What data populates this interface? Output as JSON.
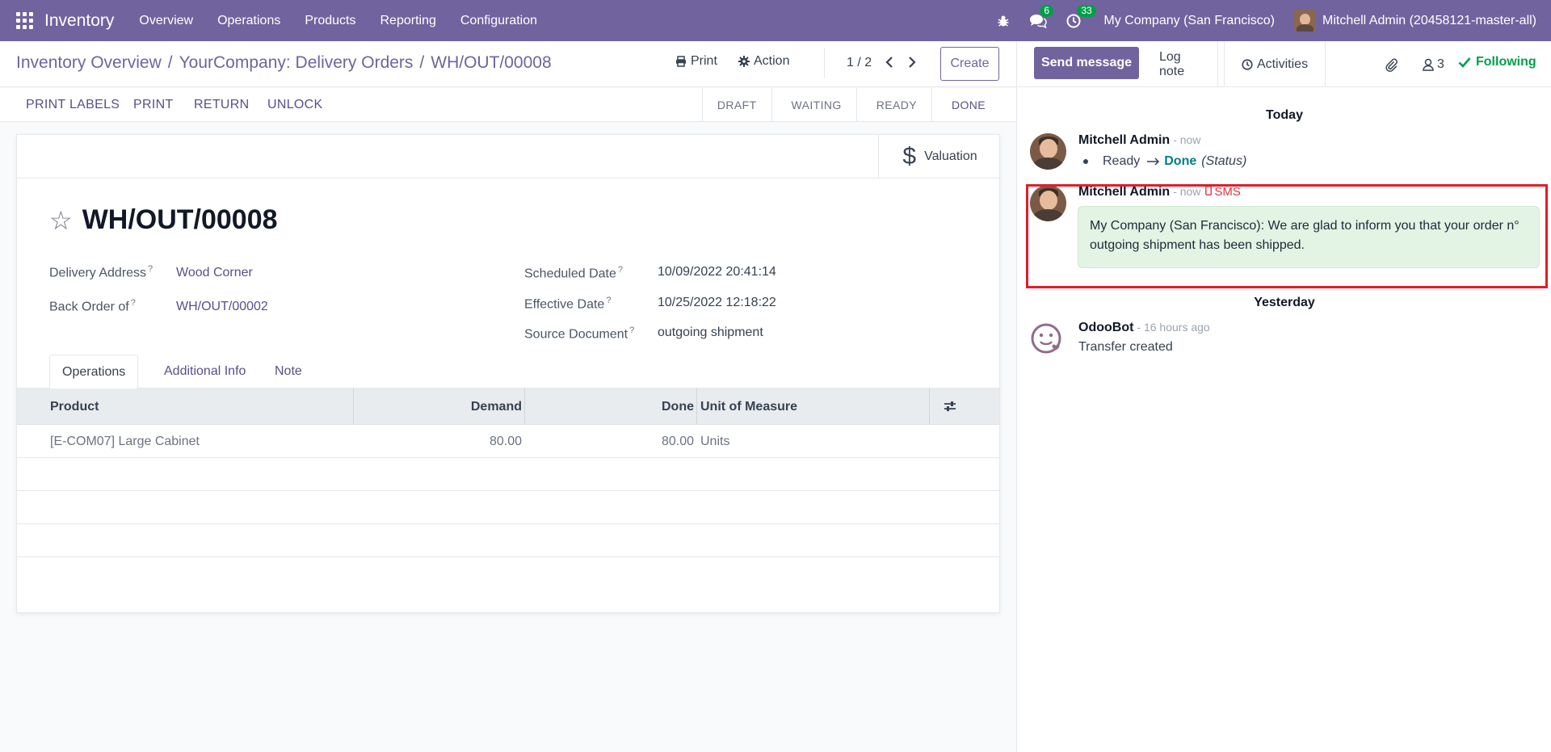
{
  "navbar": {
    "app_name": "Inventory",
    "menu": [
      "Overview",
      "Operations",
      "Products",
      "Reporting",
      "Configuration"
    ],
    "messages_count": "6",
    "activities_count": "33",
    "company": "My Company (San Francisco)",
    "user": "Mitchell Admin (20458121-master-all)",
    "colors": {
      "navbar": "#71639e",
      "badge": "#00a04a"
    }
  },
  "breadcrumb": {
    "items": [
      "Inventory Overview",
      "YourCompany: Delivery Orders"
    ],
    "current": "WH/OUT/00008"
  },
  "control": {
    "print": "Print",
    "action": "Action",
    "pager": "1 / 2",
    "create": "Create"
  },
  "statusbar": {
    "actions": [
      "PRINT LABELS",
      "PRINT",
      "RETURN",
      "UNLOCK"
    ],
    "steps": [
      "DRAFT",
      "WAITING",
      "READY",
      "DONE"
    ],
    "current_step": "DONE"
  },
  "form": {
    "valuation": "Valuation",
    "title": "WH/OUT/00008",
    "delivery_address_label": "Delivery Address",
    "delivery_address": "Wood Corner",
    "back_order_label": "Back Order of",
    "back_order": "WH/OUT/00002",
    "scheduled_date_label": "Scheduled Date",
    "scheduled_date": "10/09/2022 20:41:14",
    "effective_date_label": "Effective Date",
    "effective_date": "10/25/2022 12:18:22",
    "source_document_label": "Source Document",
    "source_document": "outgoing shipment",
    "help_mark": "?",
    "tabs": [
      "Operations",
      "Additional Info",
      "Note"
    ],
    "table": {
      "headers": [
        "Product",
        "Demand",
        "Done",
        "Unit of Measure"
      ],
      "rows": [
        {
          "product": "[E-COM07] Large Cabinet",
          "demand": "80.00",
          "done": "80.00",
          "uom": "Units"
        }
      ]
    }
  },
  "chatter": {
    "send_message": "Send message",
    "log_note": "Log note",
    "activities": "Activities",
    "followers_count": "3",
    "following": "Following",
    "today": "Today",
    "yesterday": "Yesterday",
    "messages": [
      {
        "author": "Mitchell Admin",
        "time": "- now",
        "tracking_from": "Ready",
        "tracking_to": "Done",
        "tracking_field": "(Status)"
      },
      {
        "author": "Mitchell Admin",
        "time": "- now",
        "type": "SMS",
        "body": "My Company (San Francisco): We are glad to inform you that your order n° outgoing shipment has been shipped."
      },
      {
        "author": "OdooBot",
        "time": "- 16 hours ago",
        "body": "Transfer created"
      }
    ]
  }
}
